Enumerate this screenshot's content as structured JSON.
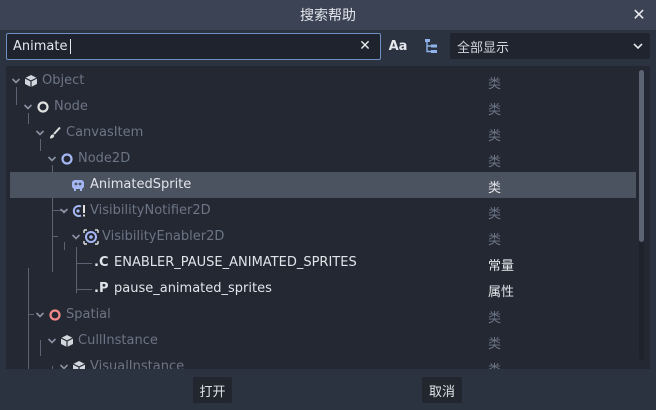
{
  "dialog": {
    "title": "搜索帮助"
  },
  "search": {
    "value": "Animate",
    "filter_selected": "全部显示"
  },
  "tree": {
    "rows": [
      {
        "label": "Object",
        "type": "类"
      },
      {
        "label": "Node",
        "type": "类"
      },
      {
        "label": "CanvasItem",
        "type": "类"
      },
      {
        "label": "Node2D",
        "type": "类"
      },
      {
        "label": "AnimatedSprite",
        "type": "类"
      },
      {
        "label": "VisibilityNotifier2D",
        "type": "类"
      },
      {
        "label": "VisibilityEnabler2D",
        "type": "类"
      },
      {
        "label": "ENABLER_PAUSE_ANIMATED_SPRITES",
        "type": "常量",
        "prefix": ".C"
      },
      {
        "label": "pause_animated_sprites",
        "type": "属性",
        "prefix": ".P"
      },
      {
        "label": "Spatial",
        "type": "类"
      },
      {
        "label": "CullInstance",
        "type": "类"
      },
      {
        "label": "VisualInstance",
        "type": "类"
      }
    ]
  },
  "footer": {
    "open_label": "打开",
    "cancel_label": "取消"
  },
  "colors": {
    "accent": "#6e8fbf",
    "selection": "#4b5260",
    "node_red": "#f48a8a",
    "node_blue": "#a5b7f3"
  }
}
